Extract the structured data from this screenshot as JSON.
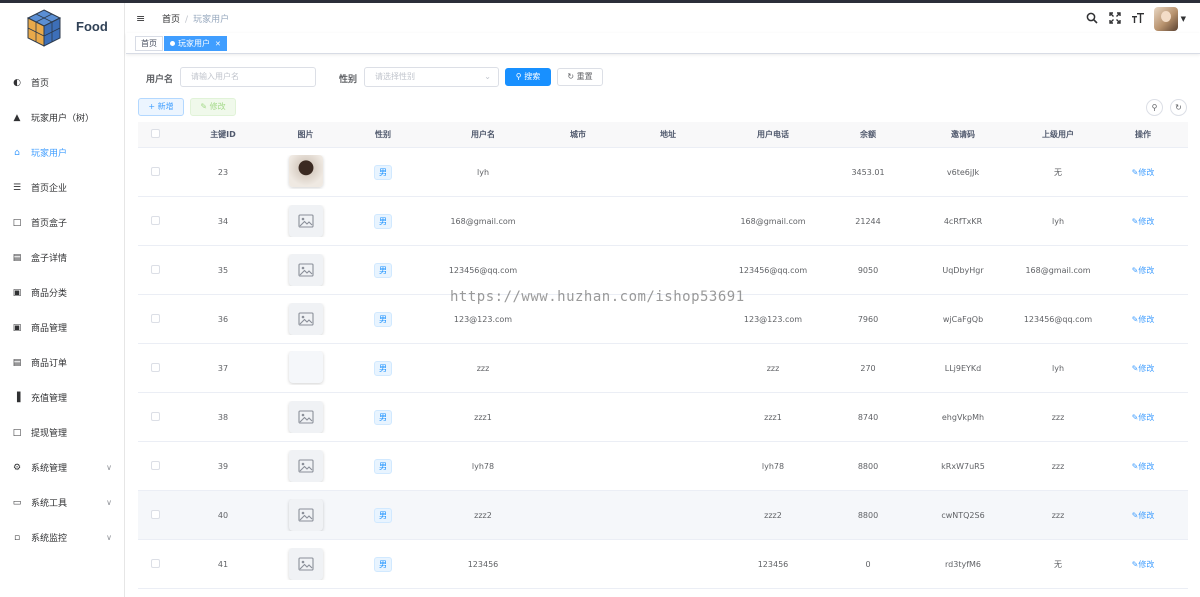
{
  "app": {
    "name": "Food"
  },
  "sidebar": {
    "items": [
      {
        "label": "首页",
        "icon": "dashboard-icon",
        "glyph": "◐",
        "active": false,
        "chevron": false
      },
      {
        "label": "玩家用户（树）",
        "icon": "user-icon",
        "glyph": "▲",
        "active": false,
        "chevron": false
      },
      {
        "label": "玩家用户",
        "icon": "peoples-icon",
        "glyph": "⌂",
        "active": true,
        "chevron": false
      },
      {
        "label": "首页企业",
        "icon": "list-icon",
        "glyph": "☰",
        "active": false,
        "chevron": false
      },
      {
        "label": "首页盒子",
        "icon": "book-icon",
        "glyph": "□",
        "active": false,
        "chevron": false
      },
      {
        "label": "盒子详情",
        "icon": "document-icon",
        "glyph": "▤",
        "active": false,
        "chevron": false
      },
      {
        "label": "商品分类",
        "icon": "copy-icon",
        "glyph": "▣",
        "active": false,
        "chevron": false
      },
      {
        "label": "商品管理",
        "icon": "copy-icon",
        "glyph": "▣",
        "active": false,
        "chevron": false
      },
      {
        "label": "商品订单",
        "icon": "document-icon",
        "glyph": "▤",
        "active": false,
        "chevron": false
      },
      {
        "label": "充值管理",
        "icon": "chart-icon",
        "glyph": "▐",
        "active": false,
        "chevron": false
      },
      {
        "label": "提现管理",
        "icon": "book-icon",
        "glyph": "□",
        "active": false,
        "chevron": false
      },
      {
        "label": "系统管理",
        "icon": "gear-icon",
        "glyph": "⚙",
        "active": false,
        "chevron": true
      },
      {
        "label": "系统工具",
        "icon": "toolbox-icon",
        "glyph": "▭",
        "active": false,
        "chevron": true
      },
      {
        "label": "系统监控",
        "icon": "monitor-icon",
        "glyph": "▫",
        "active": false,
        "chevron": true
      }
    ]
  },
  "header": {
    "breadcrumb": [
      "首页",
      "玩家用户"
    ],
    "icons": [
      "search-icon",
      "fullscreen-icon",
      "font-size-icon"
    ]
  },
  "tags": [
    {
      "label": "首页",
      "active": false
    },
    {
      "label": "玩家用户",
      "active": true
    }
  ],
  "search": {
    "username_label": "用户名",
    "username_placeholder": "请输入用户名",
    "gender_label": "性别",
    "gender_placeholder": "请选择性别",
    "search_button": "搜索",
    "reset_button": "重置"
  },
  "toolbar": {
    "add_button": "新增",
    "edit_button": "修改"
  },
  "table": {
    "columns": [
      "",
      "主键ID",
      "图片",
      "性别",
      "用户名",
      "城市",
      "地址",
      "用户电话",
      "余额",
      "邀请码",
      "上级用户",
      "操作"
    ],
    "action_label": "修改",
    "rows": [
      {
        "id": "23",
        "image": "photo",
        "gender": "男",
        "username": "lyh",
        "city": "",
        "address": "",
        "phone": "",
        "balance": "3453.01",
        "invite": "v6te6jJk",
        "parent": "无"
      },
      {
        "id": "34",
        "image": "placeholder",
        "gender": "男",
        "username": "168@gmail.com",
        "city": "",
        "address": "",
        "phone": "168@gmail.com",
        "balance": "21244",
        "invite": "4cRfTxKR",
        "parent": "lyh"
      },
      {
        "id": "35",
        "image": "placeholder",
        "gender": "男",
        "username": "123456@qq.com",
        "city": "",
        "address": "",
        "phone": "123456@qq.com",
        "balance": "9050",
        "invite": "UqDbyHgr",
        "parent": "168@gmail.com"
      },
      {
        "id": "36",
        "image": "placeholder",
        "gender": "男",
        "username": "123@123.com",
        "city": "",
        "address": "",
        "phone": "123@123.com",
        "balance": "7960",
        "invite": "wjCaFgQb",
        "parent": "123456@qq.com"
      },
      {
        "id": "37",
        "image": "blank",
        "gender": "男",
        "username": "zzz",
        "city": "",
        "address": "",
        "phone": "zzz",
        "balance": "270",
        "invite": "LLj9EYKd",
        "parent": "lyh"
      },
      {
        "id": "38",
        "image": "placeholder",
        "gender": "男",
        "username": "zzz1",
        "city": "",
        "address": "",
        "phone": "zzz1",
        "balance": "8740",
        "invite": "ehgVkpMh",
        "parent": "zzz"
      },
      {
        "id": "39",
        "image": "placeholder",
        "gender": "男",
        "username": "lyh78",
        "city": "",
        "address": "",
        "phone": "lyh78",
        "balance": "8800",
        "invite": "kRxW7uR5",
        "parent": "zzz"
      },
      {
        "id": "40",
        "image": "placeholder",
        "gender": "男",
        "username": "zzz2",
        "city": "",
        "address": "",
        "phone": "zzz2",
        "balance": "8800",
        "invite": "cwNTQ2S6",
        "parent": "zzz"
      },
      {
        "id": "41",
        "image": "placeholder",
        "gender": "男",
        "username": "123456",
        "city": "",
        "address": "",
        "phone": "123456",
        "balance": "0",
        "invite": "rd3tyfM6",
        "parent": "无"
      }
    ]
  },
  "watermark": "https://www.huzhan.com/ishop53691",
  "colors": {
    "primary": "#1890ff",
    "sidebar_active": "#409eff",
    "header_bg": "#f8f8f9"
  }
}
